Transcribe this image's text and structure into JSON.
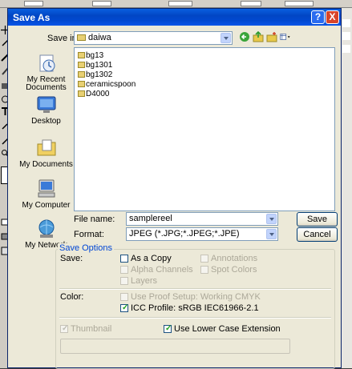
{
  "dialog": {
    "title": "Save As",
    "help_label": "?",
    "close_label": "X"
  },
  "save_in": {
    "label": "Save in:",
    "value": "daiwa"
  },
  "places": [
    {
      "label_line1": "My Recent",
      "label_line2": "Documents",
      "icon": "recent-documents-icon"
    },
    {
      "label_line1": "Desktop",
      "label_line2": "",
      "icon": "desktop-icon"
    },
    {
      "label_line1": "My Documents",
      "label_line2": "",
      "icon": "my-documents-icon"
    },
    {
      "label_line1": "My Computer",
      "label_line2": "",
      "icon": "my-computer-icon"
    },
    {
      "label_line1": "My Network",
      "label_line2": "",
      "icon": "my-network-icon"
    }
  ],
  "files": [
    "bg13",
    "bg1301",
    "bg1302",
    "ceramicspoon",
    "D4000"
  ],
  "file_name": {
    "label": "File name:",
    "value": "samplereel"
  },
  "format": {
    "label": "Format:",
    "value": "JPEG (*.JPG;*.JPEG;*.JPE)"
  },
  "buttons": {
    "save": "Save",
    "cancel": "Cancel"
  },
  "save_options": {
    "title": "Save Options",
    "save_label": "Save:",
    "as_copy": "As a Copy",
    "annotations": "Annotations",
    "alpha_channels": "Alpha Channels",
    "spot_colors": "Spot Colors",
    "layers": "Layers",
    "color_label": "Color:",
    "use_proof_setup": "Use Proof Setup:  Working CMYK",
    "icc_profile": "ICC Profile:  sRGB IEC61966-2.1",
    "thumbnail": "Thumbnail",
    "lower_case_ext": "Use Lower Case Extension",
    "checkmark": "✓"
  },
  "colors": {
    "titlebar": "#0148d0",
    "group_title": "#0046d5",
    "dialog_bg": "#ece9d8"
  }
}
